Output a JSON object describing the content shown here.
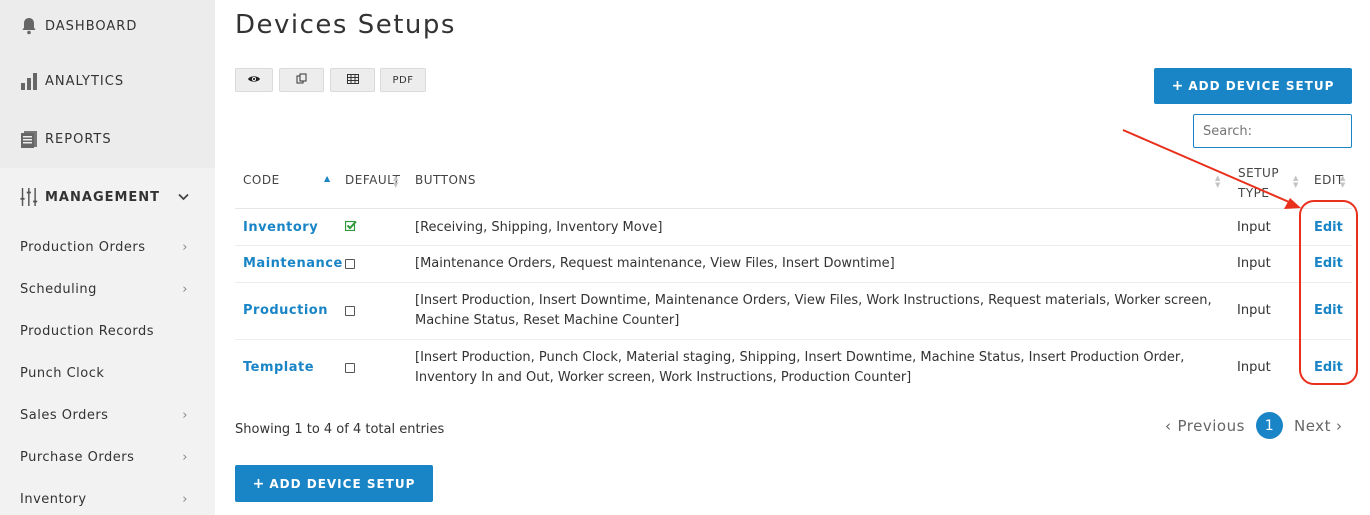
{
  "sidebar": {
    "top_items": [
      {
        "label": "DASHBOARD",
        "icon": "bell-icon"
      },
      {
        "label": "ANALYTICS",
        "icon": "bar-chart-icon"
      },
      {
        "label": "REPORTS",
        "icon": "document-icon"
      }
    ],
    "management": {
      "label": "MANAGEMENT",
      "icon": "sliders-icon"
    },
    "sub_items": [
      {
        "label": "Production Orders",
        "has_chevron": true
      },
      {
        "label": "Scheduling",
        "has_chevron": true
      },
      {
        "label": "Production Records",
        "has_chevron": false
      },
      {
        "label": "Punch Clock",
        "has_chevron": false
      },
      {
        "label": "Sales Orders",
        "has_chevron": true
      },
      {
        "label": "Purchase Orders",
        "has_chevron": true
      },
      {
        "label": "Inventory",
        "has_chevron": true
      }
    ]
  },
  "page": {
    "title": "Devices Setups",
    "toolbar": {
      "view_icon": "eye-icon",
      "copy_icon": "copy-icon",
      "excel_icon": "table-icon",
      "pdf_label": "PDF"
    },
    "add_button_label": "ADD DEVICE SETUP",
    "search_placeholder": "Search:"
  },
  "table": {
    "headers": {
      "code": "CODE",
      "default": "DEFAULT",
      "buttons": "BUTTONS",
      "setup_type_line1": "SETUP",
      "setup_type_line2": "TYPE",
      "edit": "EDIT"
    },
    "rows": [
      {
        "code": "Inventory",
        "default": true,
        "buttons": "[Receiving, Shipping, Inventory Move]",
        "setup_type": "Input",
        "edit": "Edit"
      },
      {
        "code": "Maintenance",
        "default": false,
        "buttons": "[Maintenance Orders, Request maintenance, View Files, Insert Downtime]",
        "setup_type": "Input",
        "edit": "Edit"
      },
      {
        "code": "Production",
        "default": false,
        "buttons": "[Insert Production, Insert Downtime, Maintenance Orders, View Files, Work Instructions, Request materials, Worker screen, Machine Status, Reset Machine Counter]",
        "setup_type": "Input",
        "edit": "Edit"
      },
      {
        "code": "Template",
        "default": false,
        "buttons": "[Insert Production, Punch Clock, Material staging, Shipping, Insert Downtime, Machine Status, Insert Production Order, Inventory In and Out, Worker screen, Work Instructions, Production Counter]",
        "setup_type": "Input",
        "edit": "Edit"
      }
    ]
  },
  "footer": {
    "info": "Showing 1 to 4 of 4 total entries",
    "prev_label": "Previous",
    "page_number": "1",
    "next_label": "Next"
  },
  "colors": {
    "accent": "#1a85c6",
    "annotation": "#e8301c",
    "sidebar_bg": "#ececec",
    "check": "#2e9a3a"
  }
}
